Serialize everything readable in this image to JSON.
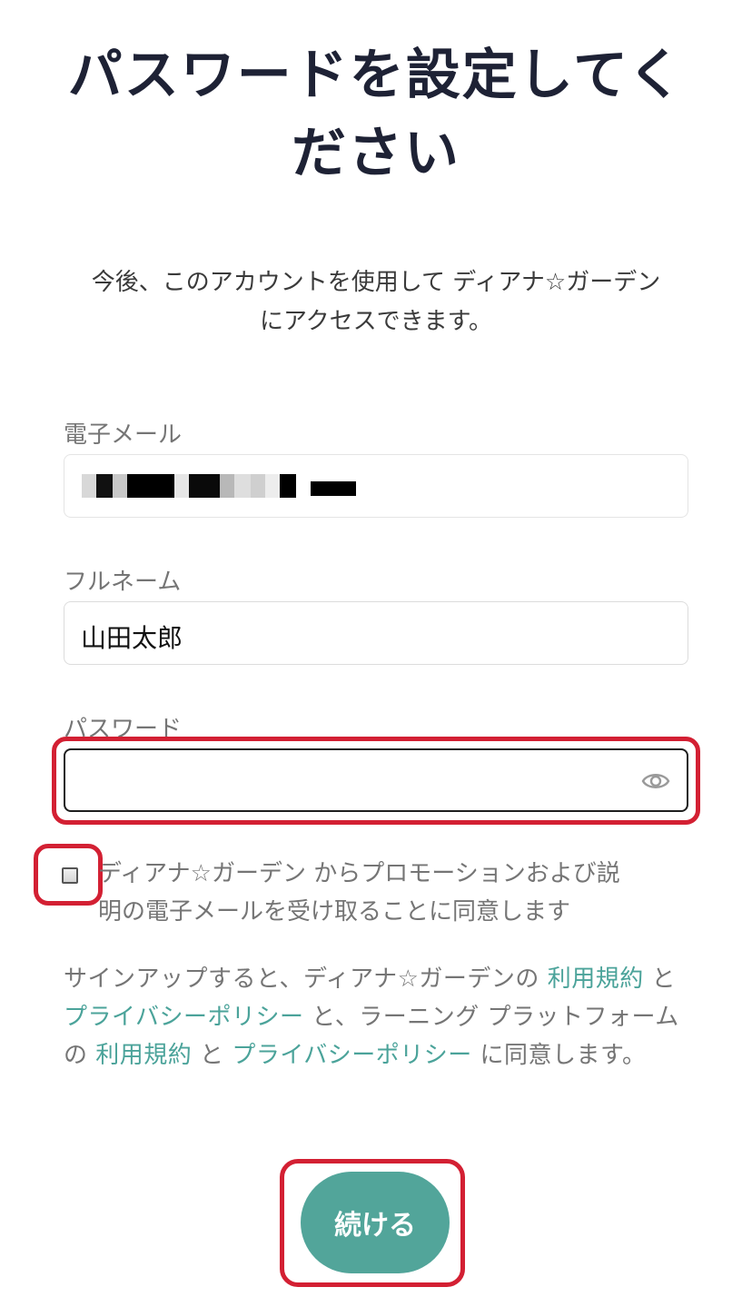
{
  "heading": {
    "line1": "パスワードを設定してく",
    "line2": "ださい"
  },
  "intro": {
    "line1": "今後、このアカウントを使用して ディアナ☆ガーデン",
    "line2": "にアクセスできます。"
  },
  "form": {
    "email_label": "電子メール",
    "fullname_label": "フルネーム",
    "fullname_value": "山田太郎",
    "password_label": "パスワード",
    "password_value": ""
  },
  "consent": {
    "line1": "ディアナ☆ガーデン からプロモーションおよび説",
    "line2": "明の電子メールを受け取ることに同意します",
    "checked": false
  },
  "legal": {
    "part1": "サインアップすると、ディアナ☆ガーデンの ",
    "link1": "利用規約",
    "part2": " と ",
    "link2": "プライバシーポリシー",
    "part3": " と、ラーニング プラットフォームの ",
    "link3": "利用規約",
    "part4": " と ",
    "link4": "プライバシーポリシー",
    "part5": " に同意します。"
  },
  "continue_label": "続ける",
  "colors": {
    "accent": "#52a59a",
    "link": "#4ba39a",
    "highlight": "#d32033",
    "heading": "#1e2235"
  }
}
